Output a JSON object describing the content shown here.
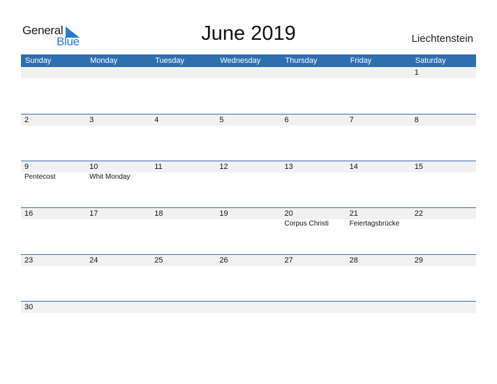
{
  "logo": {
    "word1": "General",
    "word2": "Blue"
  },
  "title": "June 2019",
  "country": "Liechtenstein",
  "colors": {
    "accent": "#2f6fb0",
    "band": "#f1f1f1",
    "logo_blue": "#2a7bd0"
  },
  "weekdays": [
    "Sunday",
    "Monday",
    "Tuesday",
    "Wednesday",
    "Thursday",
    "Friday",
    "Saturday"
  ],
  "weeks": [
    [
      {
        "day": "",
        "event": ""
      },
      {
        "day": "",
        "event": ""
      },
      {
        "day": "",
        "event": ""
      },
      {
        "day": "",
        "event": ""
      },
      {
        "day": "",
        "event": ""
      },
      {
        "day": "",
        "event": ""
      },
      {
        "day": "1",
        "event": ""
      }
    ],
    [
      {
        "day": "2",
        "event": ""
      },
      {
        "day": "3",
        "event": ""
      },
      {
        "day": "4",
        "event": ""
      },
      {
        "day": "5",
        "event": ""
      },
      {
        "day": "6",
        "event": ""
      },
      {
        "day": "7",
        "event": ""
      },
      {
        "day": "8",
        "event": ""
      }
    ],
    [
      {
        "day": "9",
        "event": "Pentecost"
      },
      {
        "day": "10",
        "event": "Whit Monday"
      },
      {
        "day": "11",
        "event": ""
      },
      {
        "day": "12",
        "event": ""
      },
      {
        "day": "13",
        "event": ""
      },
      {
        "day": "14",
        "event": ""
      },
      {
        "day": "15",
        "event": ""
      }
    ],
    [
      {
        "day": "16",
        "event": ""
      },
      {
        "day": "17",
        "event": ""
      },
      {
        "day": "18",
        "event": ""
      },
      {
        "day": "19",
        "event": ""
      },
      {
        "day": "20",
        "event": "Corpus Christi"
      },
      {
        "day": "21",
        "event": "Feiertagsbrücke"
      },
      {
        "day": "22",
        "event": ""
      }
    ],
    [
      {
        "day": "23",
        "event": ""
      },
      {
        "day": "24",
        "event": ""
      },
      {
        "day": "25",
        "event": ""
      },
      {
        "day": "26",
        "event": ""
      },
      {
        "day": "27",
        "event": ""
      },
      {
        "day": "28",
        "event": ""
      },
      {
        "day": "29",
        "event": ""
      }
    ],
    [
      {
        "day": "30",
        "event": ""
      },
      {
        "day": "",
        "event": ""
      },
      {
        "day": "",
        "event": ""
      },
      {
        "day": "",
        "event": ""
      },
      {
        "day": "",
        "event": ""
      },
      {
        "day": "",
        "event": ""
      },
      {
        "day": "",
        "event": ""
      }
    ]
  ]
}
